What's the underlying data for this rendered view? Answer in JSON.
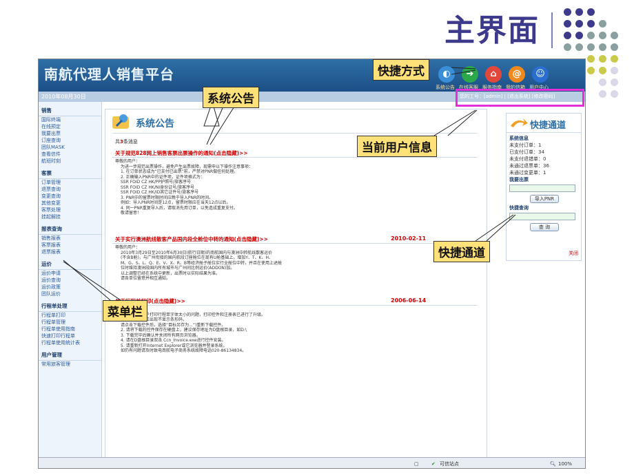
{
  "slide": {
    "title": "主界面"
  },
  "app": {
    "brand": "南航代理人销售平台",
    "date": "2010年08月30日",
    "quick_links": [
      {
        "label": "系统公告",
        "icon": "speaker-icon",
        "color": "#3a8fd8"
      },
      {
        "label": "在线客服",
        "icon": "arrow-right-icon",
        "color": "#2aa84a"
      },
      {
        "label": "服务指南",
        "icon": "guide-icon",
        "color": "#e0483c"
      },
      {
        "label": "我的信箱",
        "icon": "mail-icon",
        "color": "#f08a1c"
      },
      {
        "label": "用户中心",
        "icon": "user-icon",
        "color": "#2a6fd0"
      }
    ],
    "user_info": "您的工号：[admin]    |    [退出系统]  [修改密码]"
  },
  "menu": {
    "sections": [
      {
        "title": "销售",
        "items": [
          "国际终端",
          "在线预定",
          "我要出票",
          "订座查询",
          "团队MASK",
          "查看信件",
          "航班时刻"
        ]
      },
      {
        "title": "客票",
        "items": [
          "订单管理",
          "退票查询",
          "变更查询",
          "其他变更",
          "客票处理",
          "挂起解挂"
        ]
      },
      {
        "title": "报表查询",
        "items": [
          "销售报表",
          "客票报表",
          "退票报表"
        ]
      },
      {
        "title": "运价",
        "items": [
          "运价申请",
          "运价查询",
          "运价政策",
          "团队运价"
        ]
      },
      {
        "title": "行程单处理",
        "items": [
          "行程单打印",
          "行程单管理",
          "行程单使用指南",
          "快速打印行程单",
          "行程单使用统计表"
        ]
      },
      {
        "title": "用户管理",
        "items": [
          "常用旅客管理"
        ]
      }
    ]
  },
  "notices": {
    "header": "系统公告",
    "count_prefix": "共",
    "count": "3",
    "count_suffix": "条消息",
    "items": [
      {
        "title": "关于规范828网上销售客票出票操作的通知(点击隐藏)>>",
        "date": "",
        "body": [
          "尊敬的用户：",
          "为进一步规范出票操作，避免产生出票故障，现需申以下操作注意事项：",
          "1. 在订单状态成为“已支付已出票”前，严禁对PNR做任何处理。",
          "2. 正确输入PNR中的证件项，证件项格式为：",
          "SSR FOID CZ HK/PP护照号/旅客序号",
          "SSR FOID CZ HK/NI身份证号/旅客序号",
          "SSR FOID CZ HK/ID其它证件号/旅客序号",
          "3. PNR中的留票时限时间应晚于导入PNR的时间。",
          "例如：导入PNR时间是12点，留票时限应在当天12点以后。",
          "4. 同一PNR重复导入后，请取消先用订单，以免造成重复支付。",
          "敬请留意！"
        ]
      },
      {
        "title": "关于实行澳洲航线散客产品国内段全舱位中转的通知(点击隐藏)>>",
        "date": "2010-02-11",
        "body": [
          "尊敬的用户：",
          "2010年3月29日至2010年6月30日(航行日期)的南航国内与澳洲中转航线散客运价",
          "(不含B舱)，与广州衔接的国内航段订座舱位在现有U舱基础上，增加Y、T、K、H、",
          "M、G、S、L、Q、E、V、X、R、B等经济舱子舱位实行全舱位中转，并且在使用上述舱",
          "位时维持澳洲段国内所有城市与广州间比例运价(ADDON)加。",
          "以上调整已经在系统中更新，出票时以实际结果为准。",
          "请各单位留意并相互通知。"
        ]
      },
      {
        "title": "关于行程单打印(点击隐藏)>>",
        "date": "2006-06-14",
        "body": [
          "尊敬的用户：",
          "为解决部分用户打印行程单字体太小的问题，打印控件和注册表已进行了升级。",
          "行程单打印时若出现不显示条形码，",
          "请点击下载控件后，选择“目标另存为...”)重新下载控件。",
          "2. 请将下载的控件保存在硬盘上，建议保存地址为D盘根目录，如D:\\",
          "3. 下载完毕后确认并关闭所有网页浏览器。",
          "4. 请在D盘根目录双击 Ccn_Invoice.exe进行控件安装。",
          "5. 请重新打开Internet Explorer或它浏览器并登录系统。",
          "如仍有问题请及时致电南航电子商务系统故障电话020-86134834。"
        ]
      }
    ]
  },
  "quick_channel": {
    "title": "快捷通道",
    "sys_title": "系统信息",
    "stats": [
      {
        "label": "未支付订单：",
        "value": "1"
      },
      {
        "label": "已支付订单：",
        "value": "34"
      },
      {
        "label": "未支付退错单：",
        "value": "0"
      },
      {
        "label": "未通过退票单：",
        "value": "36"
      },
      {
        "label": "未通过变更单：",
        "value": "1"
      }
    ],
    "ticket_title": "我要出票",
    "import_button": "导入PNR",
    "query_title": "快捷查询",
    "query_button": "查 询",
    "close_label": "关闭"
  },
  "statusbar": {
    "zone": "可信站点",
    "zoom": "100%"
  },
  "callouts": {
    "shortcut": "快捷方式",
    "notice": "系统公告",
    "user": "当前用户信息",
    "channel": "快捷通道",
    "menu": "菜单栏"
  },
  "colors": {
    "title": "#3d3a8c",
    "callout_bg": "#ffe17a",
    "highlight_box": "#e32fd8",
    "banner": "#2e6fa6"
  }
}
